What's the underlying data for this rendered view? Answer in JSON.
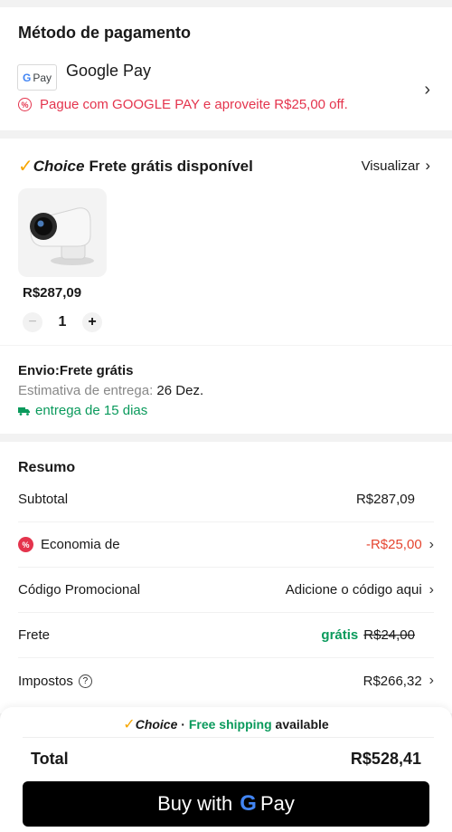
{
  "payment": {
    "title": "Método de pagamento",
    "badge_g": "G",
    "badge_pay": "Pay",
    "method_name": "Google Pay",
    "promo_icon": "%",
    "promo_text": "Pague com GOOGLE PAY e aproveite R$25,00 off.",
    "chevron": "›"
  },
  "shipping": {
    "check": "✓",
    "choice_label": "Choice",
    "headline": "Frete grátis disponível",
    "view_label": "Visualizar",
    "chevron": "›",
    "product": {
      "price": "R$287,09",
      "quantity": "1",
      "minus": "−",
      "plus": "+"
    },
    "envio_label": "Envio:Frete grátis",
    "estimate_label": "Estimativa de entrega:",
    "estimate_date": "26 Dez.",
    "delivery_days": "entrega de 15 dias"
  },
  "summary": {
    "title": "Resumo",
    "rows": {
      "subtotal": {
        "label": "Subtotal",
        "value": "R$287,09"
      },
      "savings": {
        "icon": "%",
        "label": "Economia de",
        "value": "-R$25,00"
      },
      "promo_code": {
        "label": "Código Promocional",
        "value": "Adicione o código aqui"
      },
      "shipping": {
        "label": "Frete",
        "value": "grátis",
        "old_value": "R$24,00"
      },
      "taxes": {
        "label": "Impostos",
        "help": "?",
        "value": "R$266,32"
      }
    },
    "chevron": "›"
  },
  "bottom": {
    "check": "✓",
    "choice_label": "Choice",
    "dot": " · ",
    "free_shipping": "Free shipping",
    "available": " available",
    "total_label": "Total",
    "total_value": "R$528,41",
    "buy_prefix": "Buy with",
    "buy_g": "G",
    "buy_pay": "Pay"
  },
  "colors": {
    "accent_red": "#e4344d",
    "green": "#0a9a5c",
    "choice_check": "#f7a600"
  }
}
